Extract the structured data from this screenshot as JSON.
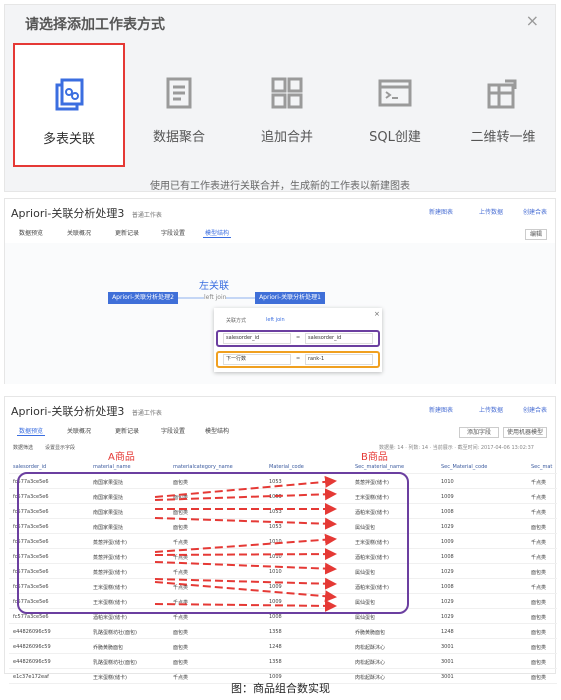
{
  "dialog": {
    "title": "请选择添加工作表方式",
    "close": "×",
    "options": [
      {
        "label": "多表关联",
        "icon": "link-sheets-icon",
        "selected": true
      },
      {
        "label": "数据聚合",
        "icon": "aggregate-icon",
        "selected": false
      },
      {
        "label": "追加合并",
        "icon": "append-merge-icon",
        "selected": false
      },
      {
        "label": "SQL创建",
        "icon": "sql-terminal-icon",
        "selected": false
      },
      {
        "label": "二维转一维",
        "icon": "pivot-icon",
        "selected": false
      }
    ],
    "hint": "使用已有工作表进行关联合并，生成新的工作表以新建图表"
  },
  "editor": {
    "title": "Apriori-关联分析处理3",
    "subtitle": "普通工作表",
    "toolbar": [
      "新建图表",
      "上传数据",
      "创建合表"
    ],
    "tabs": [
      "数据预览",
      "关联概况",
      "更新记录",
      "字段设置",
      "模型结构"
    ],
    "active_tab": "模型结构",
    "edit_button": "编辑",
    "join": {
      "left_node": "Apriori-关联分析处理2",
      "right_node": "Apriori-关联分析处理1",
      "label": "左关联",
      "label_sub": "left join",
      "dialog_title": "关联方式",
      "dialog_type": "left join",
      "dialog_close": "×",
      "key_left": "salesorder_id",
      "key_right": "salesorder_id",
      "eq": "=",
      "rank_left": "下一行数",
      "rank_right": "rank-1"
    }
  },
  "preview": {
    "title": "Apriori-关联分析处理3",
    "subtitle": "普通工作表",
    "toolbar": [
      "新建图表",
      "上传数据",
      "创建合表"
    ],
    "tabs": [
      "数据预览",
      "关联概况",
      "更新记录",
      "字段设置",
      "模型结构"
    ],
    "active_tab": "数据预览",
    "top_buttons": [
      "添加字段",
      "使用机器模型"
    ],
    "filter": "数据筛选",
    "display": "设置显示字段",
    "stats": "数据量: 14 · 列数: 14 · 当前展示 · 截至时间: 2017-04-06 13:02:37",
    "label_a": "A商品",
    "label_b": "B商品",
    "columns": [
      "salesorder_id",
      "material_name",
      "materialcategory_name",
      "Material_code",
      "Sec_material_name",
      "Sec_Material_code",
      "Sec_mat"
    ],
    "rows": [
      [
        "fc577a3ce5e6",
        "南国家果蛋挞",
        "面包类",
        "1053",
        "蒸葱拌蛋(储卡)",
        "1010",
        "千点类"
      ],
      [
        "fc577a3ce5e6",
        "南国家果蛋挞",
        "面包类",
        "1053",
        "王米蛋糕(储卡)",
        "1009",
        "千点类"
      ],
      [
        "fc577a3ce5e6",
        "南国家果蛋挞",
        "面包类",
        "1053",
        "酒粕米蛋(储卡)",
        "1008",
        "千点类"
      ],
      [
        "fc577a3ce5e6",
        "南国家果蛋挞",
        "面包类",
        "1053",
        "属仙蛋包",
        "1029",
        "面包类"
      ],
      [
        "fc577a3ce5e6",
        "蒸葱拌蛋(储卡)",
        "千点类",
        "1010",
        "王米蛋糕(储卡)",
        "1009",
        "千点类"
      ],
      [
        "fc577a3ce5e6",
        "蒸葱拌蛋(储卡)",
        "千点类",
        "1010",
        "酒粕米蛋(储卡)",
        "1008",
        "千点类"
      ],
      [
        "fc577a3ce5e6",
        "蒸葱拌蛋(储卡)",
        "千点类",
        "1010",
        "属仙蛋包",
        "1029",
        "面包类"
      ],
      [
        "fc577a3ce5e6",
        "王米蛋糕(储卡)",
        "千点类",
        "1009",
        "酒粕米蛋(储卡)",
        "1008",
        "千点类"
      ],
      [
        "fc577a3ce5e6",
        "王米蛋糕(储卡)",
        "千点类",
        "1009",
        "属仙蛋包",
        "1029",
        "面包类"
      ],
      [
        "fc577a3ce5e6",
        "酒粕米蛋(储卡)",
        "千点类",
        "1008",
        "属仙蛋包",
        "1029",
        "面包类"
      ],
      [
        "e44826096c59",
        "乳酪蛋糕坊社(面包)",
        "面包类",
        "1358",
        "乔脆黄脆面包",
        "1248",
        "面包类"
      ],
      [
        "e44826096c59",
        "乔脆黄脆面包",
        "面包类",
        "1248",
        "肉松起酥沐心",
        "3001",
        "面包类"
      ],
      [
        "e44826096c59",
        "乳酪蛋糕坊社(面包)",
        "面包类",
        "1358",
        "肉松起酥沐心",
        "3001",
        "面包类"
      ],
      [
        "e1c37e172eaf",
        "王米蛋糕(储卡)",
        "千点类",
        "1009",
        "肉松起酥沐心",
        "3001",
        "面包类"
      ]
    ]
  },
  "caption": "图：商品组合数实现",
  "colors": {
    "accent": "#3f6fd8",
    "highlight_red": "#e53935",
    "purple": "#6b3fa0",
    "orange": "#f0a020"
  }
}
